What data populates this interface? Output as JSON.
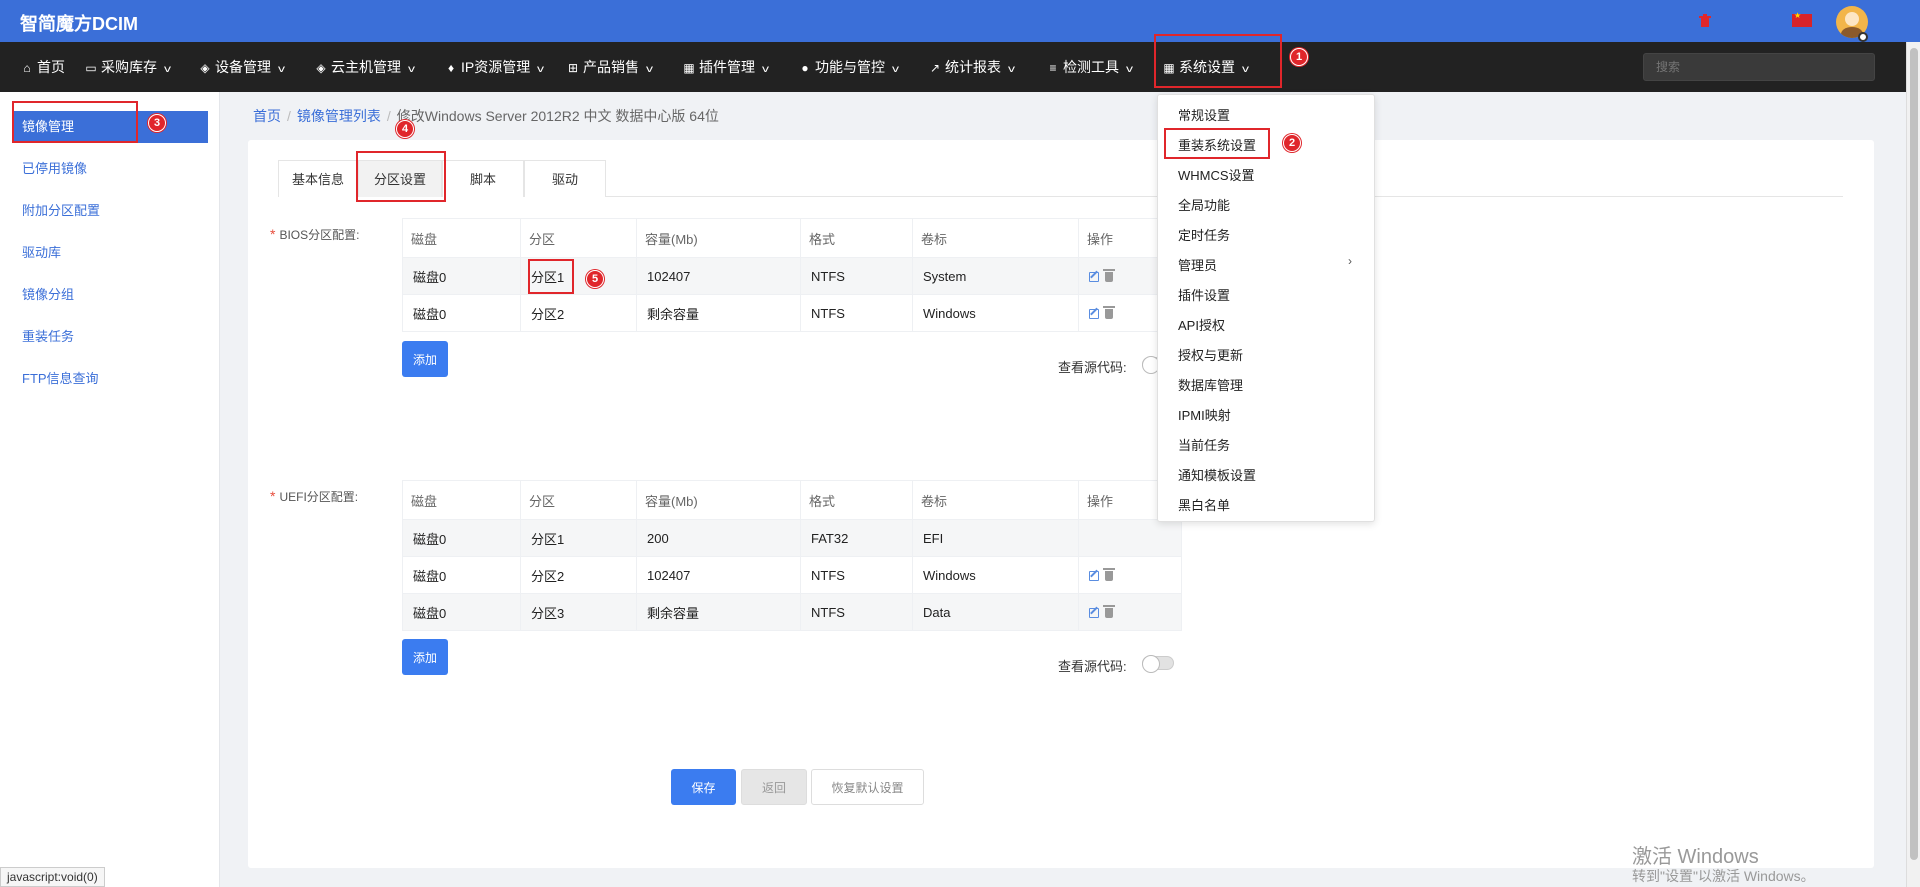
{
  "header": {
    "brand": "智简魔方DCIM"
  },
  "nav": {
    "items": [
      {
        "label": "首页",
        "icon": "home-icon"
      },
      {
        "label": "采购库存",
        "icon": "truck-icon"
      },
      {
        "label": "设备管理",
        "icon": "cube-icon"
      },
      {
        "label": "云主机管理",
        "icon": "cube-icon"
      },
      {
        "label": "IP资源管理",
        "icon": "map-marker-icon"
      },
      {
        "label": "产品销售",
        "icon": "cart-icon"
      },
      {
        "label": "插件管理",
        "icon": "grid-icon"
      },
      {
        "label": "功能与管控",
        "icon": "info-icon"
      },
      {
        "label": "统计报表",
        "icon": "line-chart-icon"
      },
      {
        "label": "检测工具",
        "icon": "list-icon"
      },
      {
        "label": "系统设置",
        "icon": "windows-icon"
      }
    ],
    "search_placeholder": "搜索"
  },
  "sidebar": {
    "items": [
      "镜像管理",
      "已停用镜像",
      "附加分区配置",
      "驱动库",
      "镜像分组",
      "重装任务",
      "FTP信息查询"
    ]
  },
  "breadcrumb": {
    "home": "首页",
    "list": "镜像管理列表",
    "current": "修改Windows Server 2012R2 中文 数据中心版 64位"
  },
  "tabs": [
    "基本信息",
    "分区设置",
    "脚本",
    "驱动"
  ],
  "bios": {
    "label": "BIOS分区配置:",
    "headers": [
      "磁盘",
      "分区",
      "容量(Mb)",
      "格式",
      "卷标",
      "操作"
    ],
    "rows": [
      {
        "disk": "磁盘0",
        "part": "分区1",
        "size": "102407",
        "fmt": "NTFS",
        "vol": "System"
      },
      {
        "disk": "磁盘0",
        "part": "分区2",
        "size": "剩余容量",
        "fmt": "NTFS",
        "vol": "Windows"
      }
    ],
    "add_label": "添加",
    "source_label": "查看源代码:"
  },
  "uefi": {
    "label": "UEFI分区配置:",
    "headers": [
      "磁盘",
      "分区",
      "容量(Mb)",
      "格式",
      "卷标",
      "操作"
    ],
    "rows": [
      {
        "disk": "磁盘0",
        "part": "分区1",
        "size": "200",
        "fmt": "FAT32",
        "vol": "EFI"
      },
      {
        "disk": "磁盘0",
        "part": "分区2",
        "size": "102407",
        "fmt": "NTFS",
        "vol": "Windows"
      },
      {
        "disk": "磁盘0",
        "part": "分区3",
        "size": "剩余容量",
        "fmt": "NTFS",
        "vol": "Data"
      }
    ],
    "add_label": "添加",
    "source_label": "查看源代码:"
  },
  "actions": {
    "save": "保存",
    "back": "返回",
    "reset": "恢复默认设置"
  },
  "dropdown": {
    "items": [
      "常规设置",
      "重装系统设置",
      "WHMCS设置",
      "全局功能",
      "定时任务",
      "管理员",
      "插件设置",
      "API授权",
      "授权与更新",
      "数据库管理",
      "IPMI映射",
      "当前任务",
      "通知模板设置",
      "黑白名单"
    ]
  },
  "annotations": [
    "1",
    "2",
    "3",
    "4",
    "5"
  ],
  "statusbar": "javascript:void(0)",
  "watermark": {
    "line1": "激活 Windows",
    "line2": "转到\"设置\"以激活 Windows。"
  },
  "colors": {
    "brand_blue": "#3b6fd8",
    "nav_dark": "#222222",
    "annotation_red": "#e0262b"
  }
}
